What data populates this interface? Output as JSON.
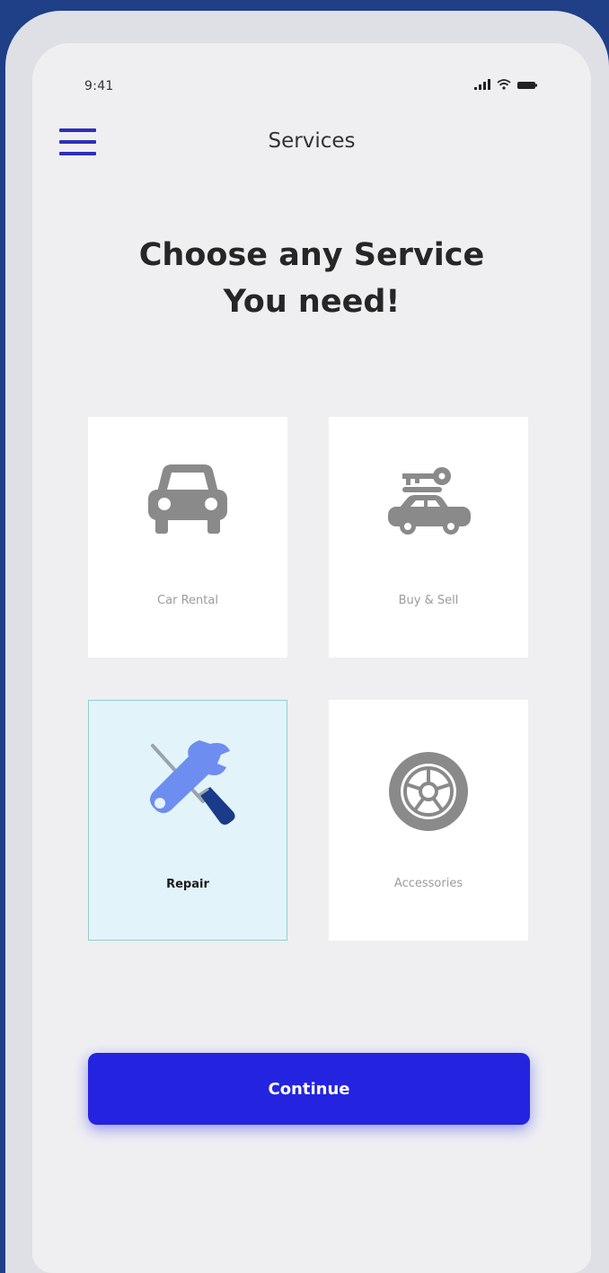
{
  "status_bar": {
    "time": "9:41"
  },
  "header": {
    "title": "Services",
    "menu_icon": "hamburger-menu-icon"
  },
  "headline": {
    "line1": "Choose any Service",
    "line2": "You need!"
  },
  "services": [
    {
      "label": "Car Rental",
      "icon": "car-icon",
      "selected": false
    },
    {
      "label": "Buy & Sell",
      "icon": "car-key-icon",
      "selected": false
    },
    {
      "label": "Repair",
      "icon": "wrench-screwdriver-icon",
      "selected": true
    },
    {
      "label": "Accessories",
      "icon": "wheel-icon",
      "selected": false
    }
  ],
  "continue_button": {
    "label": "Continue"
  },
  "colors": {
    "frame": "#1f3f86",
    "primary": "#2424e0",
    "selected_card_bg": "#e3f3fa",
    "selected_card_border": "#8ed0cf",
    "icon_gray": "#8a8a8a"
  }
}
